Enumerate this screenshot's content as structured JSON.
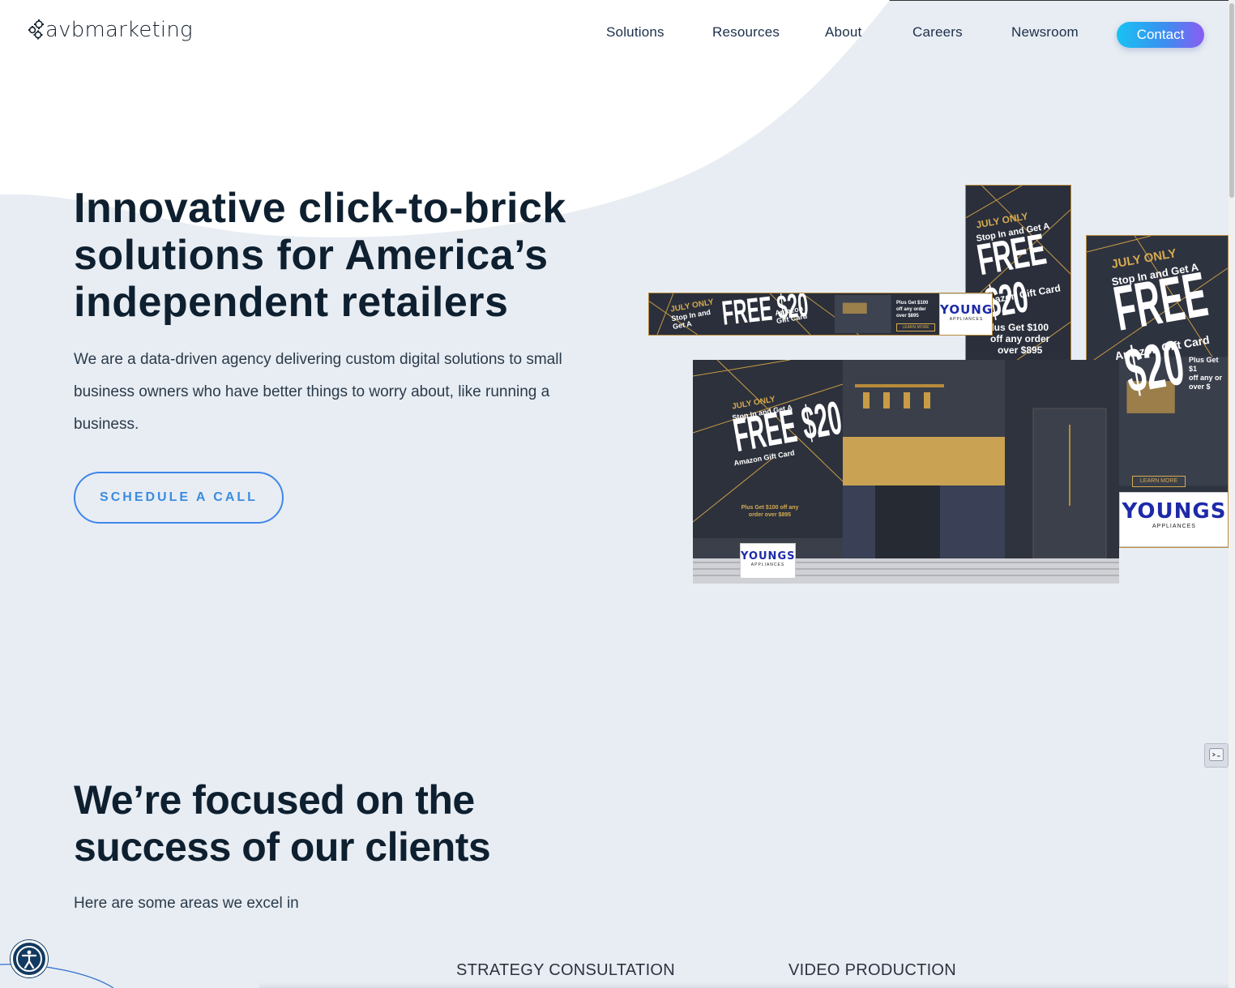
{
  "header": {
    "logo_prefix": "avb",
    "logo_suffix": "marketing",
    "nav": [
      "Solutions",
      "Resources",
      "About",
      "Careers",
      "Newsroom"
    ],
    "contact_label": "Contact"
  },
  "hero": {
    "title_lines": [
      "Innovative click-to-brick",
      "solutions for America’s",
      "independent retailers"
    ],
    "description": "We are a data-driven agency delivering custom digital solutions to small business owners who have better things to worry about, like running a business.",
    "cta_label": "SCHEDULE A CALL"
  },
  "ads": {
    "july_only": "JULY ONLY",
    "stop_in": "Stop In and Get A",
    "stop_in_short_1": "Stop In and",
    "stop_in_short_2": "Get A",
    "free": "FREE",
    "amount": "$20",
    "gift_card": "Amazon Gift Card",
    "amazon": "Amazon",
    "gift_card_short": "Gift Card",
    "plus_get": "Plus Get $100 off any order over $895",
    "plus_get_short": "Plus Get $100",
    "off_any": "off any order",
    "over": "over $895",
    "lus_get": "lus Get $100",
    "off_any_order": "off any order",
    "over_895": "over $895",
    "plus_get_2": "Plus Get $1",
    "off_any_2": "off any or",
    "over_2": "over $",
    "learn_more": "LEARN MORE",
    "brand": "YOUNGS",
    "brand_sub": "APPLIANCES"
  },
  "section2": {
    "title_lines": [
      "We’re focused on the",
      "success of our clients"
    ],
    "subtitle": "Here are some areas we excel in",
    "services": [
      "STRATEGY CONSULTATION",
      "VIDEO PRODUCTION"
    ]
  },
  "colors": {
    "background": "#e8edf3",
    "heading": "#0e2030",
    "accent_start": "#19c2f2",
    "accent_end": "#8a5cf2",
    "ad_dark": "#2a2f3b",
    "ad_gold": "#d6aa4e"
  },
  "icons": {
    "logo": "gears-icon",
    "accessibility": "accessibility-icon",
    "widget": "chat-widget-icon"
  }
}
